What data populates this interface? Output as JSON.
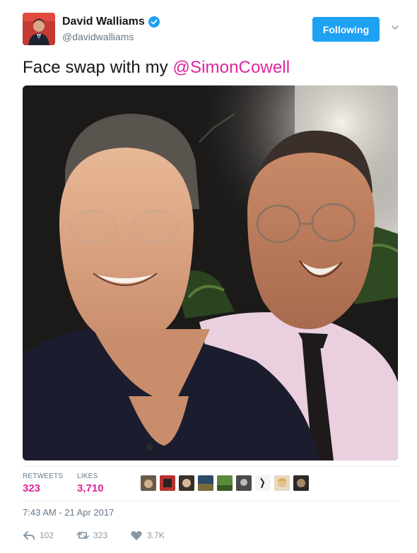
{
  "user": {
    "name": "David Walliams",
    "handle": "@davidwalliams",
    "verified": true
  },
  "follow_button": {
    "label": "Following"
  },
  "tweet": {
    "text_prefix": "Face swap with my ",
    "mention": "@SimonCowell"
  },
  "stats": {
    "retweets_label": "RETWEETS",
    "retweets_value": "323",
    "likes_label": "LIKES",
    "likes_value": "3,710"
  },
  "timestamp": "7:43 AM - 21 Apr 2017",
  "actions": {
    "reply_count": "102",
    "retweet_count": "323",
    "like_count": "3.7K"
  },
  "colors": {
    "accent": "#1da1f2",
    "highlight": "#e0249e",
    "muted": "#657786"
  }
}
